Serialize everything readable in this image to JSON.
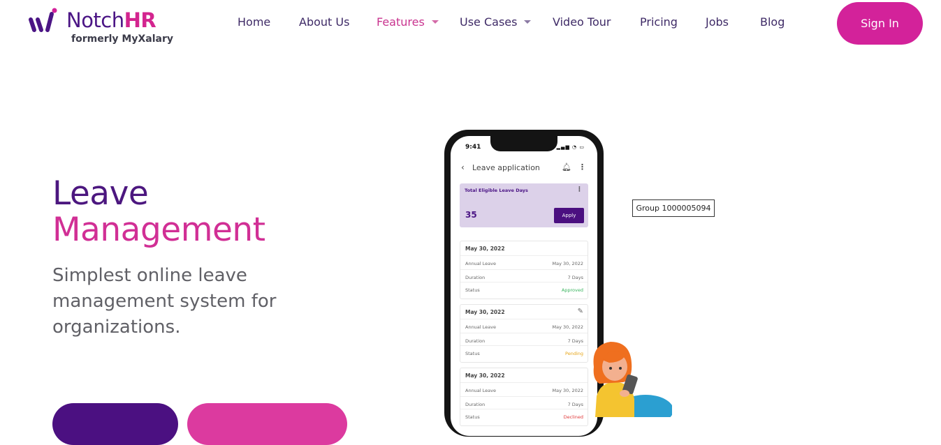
{
  "header": {
    "logo": {
      "brand_part1": "Notch",
      "brand_part2": "HR",
      "subtitle": "formerly MyXalary"
    },
    "nav": [
      {
        "label": "Home"
      },
      {
        "label": "About Us"
      },
      {
        "label": "Features",
        "active": true,
        "dropdown": true
      },
      {
        "label": "Use Cases",
        "dropdown": true
      },
      {
        "label": "Video Tour"
      },
      {
        "label": "Pricing"
      },
      {
        "label": "Jobs"
      },
      {
        "label": "Blog"
      }
    ],
    "sign_in": "Sign In"
  },
  "hero": {
    "title_line1": "Leave",
    "title_line2": "Management",
    "subtitle": "Simplest online leave management system for organizations."
  },
  "phone": {
    "time": "9:41",
    "status_icons": "signal-wifi-battery-icons",
    "header_title": "Leave application",
    "eligible_label": "Total Eligible Leave Days",
    "eligible_count": "35",
    "apply_label": "Apply",
    "cards": [
      {
        "date": "May 30, 2022",
        "type_label": "Annual Leave",
        "type_date": "May 30, 2022",
        "duration_label": "Duration",
        "duration": "7 Days",
        "status_label": "Status",
        "status": "Approved",
        "editable": false
      },
      {
        "date": "May 30, 2022",
        "type_label": "Annual Leave",
        "type_date": "May 30, 2022",
        "duration_label": "Duration",
        "duration": "7 Days",
        "status_label": "Status",
        "status": "Pending",
        "editable": true
      },
      {
        "date": "May 30, 2022",
        "type_label": "Annual Leave",
        "type_date": "May 30, 2022",
        "duration_label": "Duration",
        "duration": "7 Days",
        "status_label": "Status",
        "status": "Declined",
        "editable": false
      }
    ]
  },
  "tooltip": {
    "label": "Group 1000005094"
  },
  "colors": {
    "brand_purple": "#4b1585",
    "brand_pink": "#d3229a",
    "text_gray": "#606066",
    "approved": "#3ab55f",
    "pending": "#e6a517",
    "declined": "#e13a3a"
  }
}
